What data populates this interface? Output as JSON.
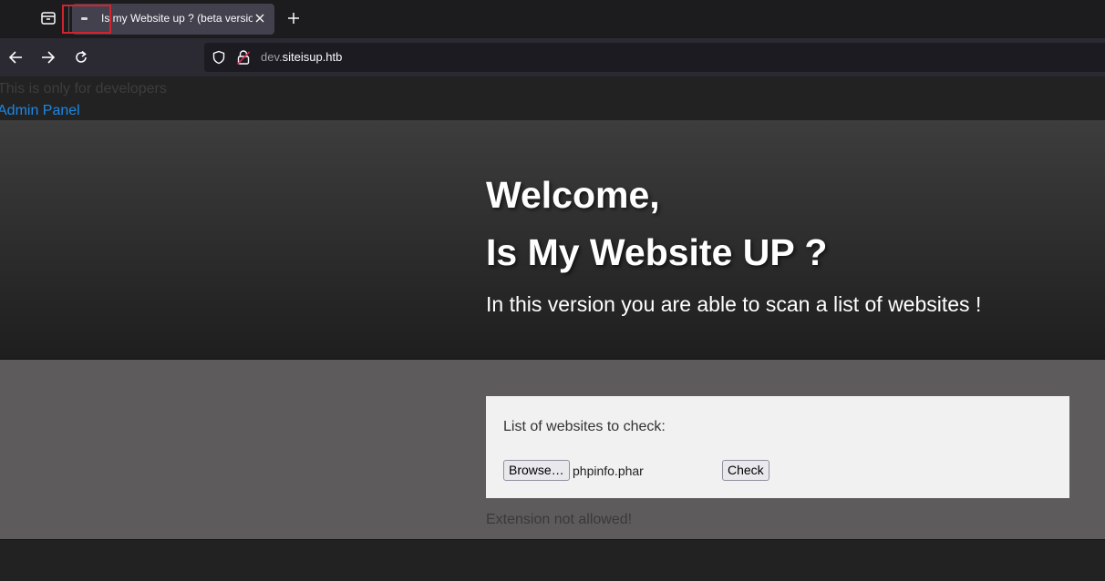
{
  "browser": {
    "tab": {
      "title": "Is my Website up ? (beta version)"
    },
    "url": {
      "subdomain": "dev.",
      "domain": "siteisup.htb"
    }
  },
  "page": {
    "dev_note": "This is only for developers",
    "admin_link": "Admin Panel",
    "hero": {
      "heading_line1": "Welcome,",
      "heading_line2": "Is My Website UP ?",
      "subtitle": "In this version you are able to scan a list of websites !"
    },
    "form": {
      "label": "List of websites to check:",
      "browse_label": "Browse…",
      "file_name": "phpinfo.phar",
      "check_label": "Check"
    },
    "error_message": "Extension not allowed!"
  },
  "colors": {
    "link": "#1e88e5",
    "highlight_box": "#d1242f",
    "hero_text": "#ffffff"
  }
}
